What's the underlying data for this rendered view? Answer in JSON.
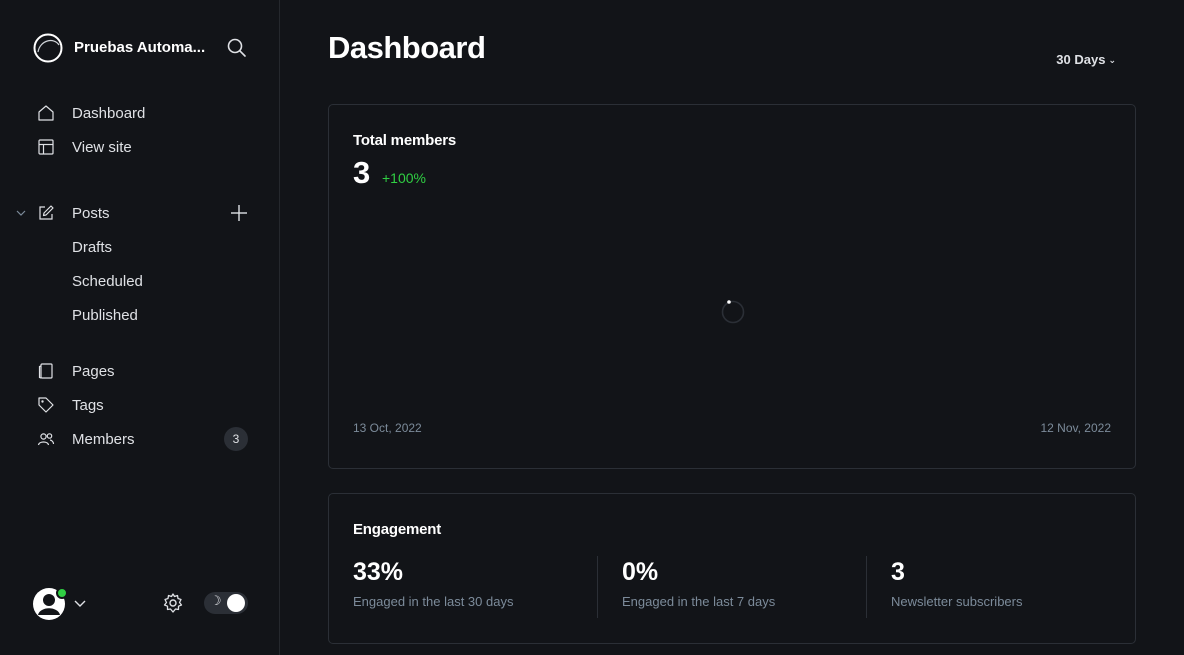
{
  "sidebar": {
    "brand_name": "Pruebas Automa...",
    "nav_primary": [
      {
        "label": "Dashboard",
        "icon": "home-icon"
      },
      {
        "label": "View site",
        "icon": "layout-icon"
      }
    ],
    "posts": {
      "label": "Posts",
      "icon": "pencil-icon",
      "sub": [
        "Drafts",
        "Scheduled",
        "Published"
      ]
    },
    "nav_secondary": [
      {
        "label": "Pages",
        "icon": "page-icon"
      },
      {
        "label": "Tags",
        "icon": "tag-icon"
      },
      {
        "label": "Members",
        "icon": "members-icon",
        "badge": "3"
      }
    ],
    "footer": {
      "theme_toggle_symbol": "☽",
      "status_color": "#30cf43"
    }
  },
  "header": {
    "title": "Dashboard",
    "range_label": "30 Days",
    "range_caret": "⌄"
  },
  "members_card": {
    "title": "Total members",
    "value": "3",
    "delta": "+100%",
    "start_date": "13 Oct, 2022",
    "end_date": "12 Nov, 2022",
    "delta_color": "#30cf43"
  },
  "engagement_card": {
    "title": "Engagement",
    "stats": [
      {
        "value": "33%",
        "label": "Engaged in the last 30 days"
      },
      {
        "value": "0%",
        "label": "Engaged in the last 7 days"
      },
      {
        "value": "3",
        "label": "Newsletter subscribers"
      }
    ]
  }
}
